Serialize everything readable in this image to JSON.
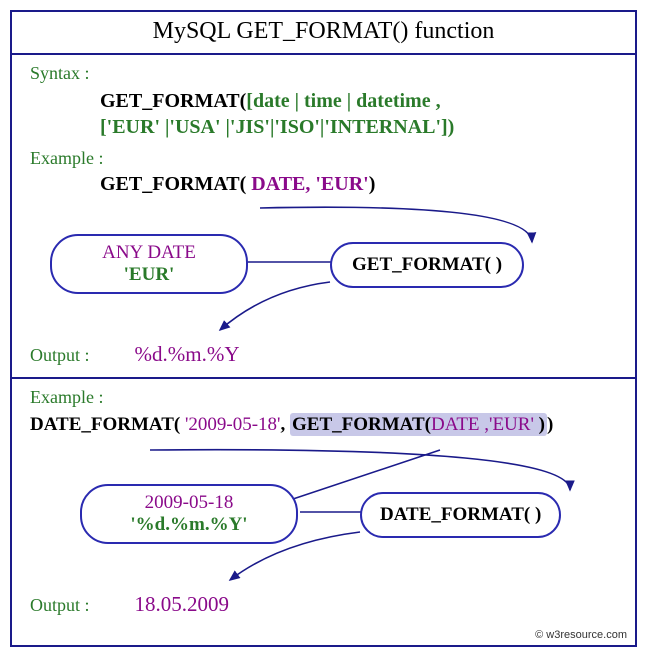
{
  "title": "MySQL  GET_FORMAT() function",
  "section1": {
    "syntax_label": "Syntax :",
    "syntax_l1_a": "GET_FORMAT(",
    "syntax_l1_b": "[date | time | datetime ,",
    "syntax_l2": "['EUR' |'USA' |'JIS'|'ISO'|'INTERNAL'])",
    "example_label": "Example :",
    "example_a": "GET_FORMAT( ",
    "example_b": "DATE, 'EUR'",
    "example_c": ")",
    "box_left_l1": "ANY DATE",
    "box_left_l2": "'EUR'",
    "box_right": "GET_FORMAT(  )",
    "output_label": "Output :",
    "output_value": "%d.%m.%Y"
  },
  "section2": {
    "example_label": "Example :",
    "expr_a": "DATE_FORMAT( ",
    "expr_b": "'2009-05-18'",
    "expr_c": ", ",
    "expr_hl_a": "GET_FORMAT(",
    "expr_hl_b": "DATE ,'EUR' ",
    "expr_hl_c": ")",
    "expr_d": ")",
    "box_left_l1": "2009-05-18",
    "box_left_l2": "'%d.%m.%Y'",
    "box_right": "DATE_FORMAT(  )",
    "output_label": "Output :",
    "output_value": "18.05.2009"
  },
  "copyright": "© w3resource.com"
}
